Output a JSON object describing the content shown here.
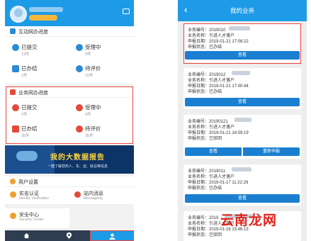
{
  "left": {
    "vip_badge": "",
    "section_interactive": {
      "title": "互动网办进度",
      "items": [
        {
          "label": "已提交",
          "count": "11件",
          "color": "#2a8bd6"
        },
        {
          "label": "受理中",
          "count": "0件",
          "color": "#2a8bd6"
        },
        {
          "label": "已办结",
          "count": "1件",
          "color": "#2a8bd6"
        },
        {
          "label": "待评价",
          "count": "10件",
          "color": "#2a8bd6"
        }
      ]
    },
    "section_business": {
      "title": "业务网办进度",
      "items": [
        {
          "label": "已提交",
          "count": "2件",
          "color": "#e24a3a"
        },
        {
          "label": "受理中",
          "count": "0件",
          "color": "#e24a3a"
        },
        {
          "label": "已办结",
          "count": "35件",
          "color": "#e24a3a"
        },
        {
          "label": "待评价",
          "count": "35件",
          "color": "#e24a3a"
        }
      ]
    },
    "banner": {
      "title": "我的大数据报告",
      "subtitle": "一键了解您的人、车、证、就业等信息"
    },
    "user_settings": {
      "title": "用户设置",
      "items": [
        {
          "title": "实名认证",
          "subtitle": "Identity Verification",
          "color": "#f0a030"
        },
        {
          "title": "站内消息",
          "subtitle": "Messageing",
          "color": "#e24a3a"
        },
        {
          "title": "安全中心",
          "subtitle": "Security Center",
          "color": "#f0a030"
        }
      ]
    },
    "tabs": [
      "home-icon",
      "location-icon",
      "user-icon"
    ]
  },
  "right": {
    "title": "我的业务",
    "back": "‹",
    "cards": [
      {
        "no_label": "业务编号：",
        "no_value": "2019010",
        "name_label": "业务名称：",
        "name_value": "引进人才落户",
        "date_label": "申报日期：",
        "date_value": "2019-01-21 17:08:22",
        "status_label": "申报状态：",
        "status_value": "已办结",
        "buttons": [
          "查看"
        ]
      },
      {
        "no_label": "业务编号：",
        "no_value": "2019012",
        "name_label": "业务名称：",
        "name_value": "引进人才落户",
        "date_label": "申报日期：",
        "date_value": "2019-01-21 17:00:44",
        "status_label": "申报状态：",
        "status_value": "已办结",
        "buttons": [
          "查看"
        ]
      },
      {
        "no_label": "业务编号：",
        "no_value": "20190121",
        "name_label": "业务名称：",
        "name_value": "引进人才落户",
        "date_label": "申报日期：",
        "date_value": "2019-01-21 16:59:19",
        "status_label": "申报状态：",
        "status_value": "已驳回",
        "buttons": [
          "查看",
          "重新申报"
        ]
      },
      {
        "no_label": "业务编号：",
        "no_value": "2019011",
        "name_label": "业务名称：",
        "name_value": "引进人才落户",
        "date_label": "申报日期：",
        "date_value": "2019-01-17 11:22:29",
        "status_label": "申报状态：",
        "status_value": "已办结",
        "buttons": [
          "查看"
        ]
      },
      {
        "no_label": "业务编号：",
        "no_value": "2019",
        "name_label": "业务名称：",
        "name_value": "引进人才落户",
        "date_label": "申报日期：",
        "date_value": "2019-01-16 15:46:13",
        "status_label": "申报状态：",
        "status_value": "已驳回",
        "buttons": []
      }
    ],
    "watermark": "云南龙网"
  },
  "colors": {
    "header_blue": "#1e9be6",
    "button_blue": "#1a7fd0",
    "highlight_red": "#ee4444",
    "tabbar_dark": "#2e3d50"
  }
}
